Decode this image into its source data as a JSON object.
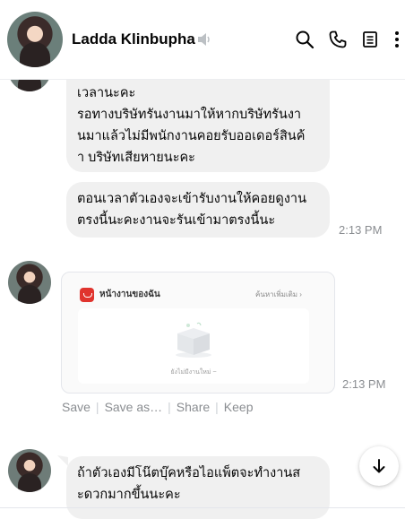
{
  "header": {
    "contact_name": "Ladda Klinbupha",
    "icons": [
      "mute-icon",
      "search-icon",
      "phone-icon",
      "notes-icon",
      "more-icon"
    ]
  },
  "messages": {
    "bubble1_lines": [
      "เวลานะคะ",
      "รอทางบริษัทรันงานมาให้หากบริษัทรันงา",
      "นมาแล้วไม่มีพนักงานคอยรับออเดอร์สินค้",
      "า บริษัทเสียหายนะคะ"
    ],
    "bubble2_lines": [
      "ตอนเวลาตัวเองจะเข้ารับงานให้คอยดูงาน",
      "ตรงนี้นะคะงานจะรันเข้ามาตรงนี้นะ"
    ],
    "bubble2_time": "2:13 PM",
    "card": {
      "title": "หน้างานของฉัน",
      "link": "ค้นหาเพิ่มเติม",
      "empty_text": "ยังไม่มีงานใหม่ ~",
      "time": "2:13 PM"
    },
    "bubble3_lines": [
      "ถ้าตัวเองมีโน๊ตบุ๊คหรือไอแพ็ตจะทำงานส",
      "ะดวกมากขึ้นนะคะ"
    ]
  },
  "actions": {
    "save": "Save",
    "save_as": "Save as…",
    "share": "Share",
    "keep": "Keep"
  },
  "colors": {
    "bubble": "#f0f0f0",
    "muted_text": "#8a8d91",
    "card_logo": "#e0342e"
  }
}
